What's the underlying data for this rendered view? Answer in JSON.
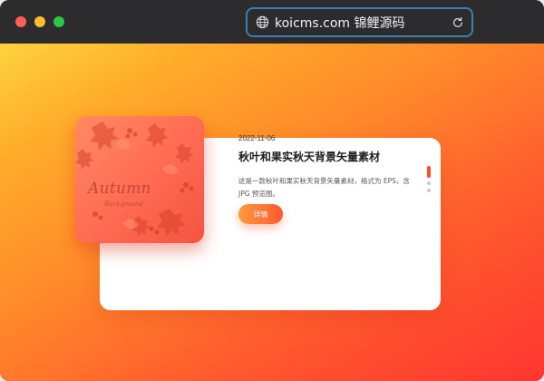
{
  "browser": {
    "address": "koicms.com 锦鲤源码",
    "icons": {
      "site": "globe-icon",
      "reload": "reload-icon"
    },
    "traffic_lights": [
      "#ff5f57",
      "#febc2e",
      "#28c840"
    ]
  },
  "article": {
    "date": "2022-11-06",
    "title": "秋叶和果实秋天背景矢量素材",
    "description": "这是一款秋叶和果实秋天背景矢量素材，格式为 EPS，含 JPG 预览图。",
    "button_label": "详情",
    "thumbnail": {
      "word": "Autumn",
      "subword": "Background"
    }
  },
  "slider": {
    "total": 3,
    "active_index": 0
  },
  "colors": {
    "accent": "#ff5a2e",
    "gradient_start": "#ffd23f",
    "gradient_end": "#ff3530"
  }
}
